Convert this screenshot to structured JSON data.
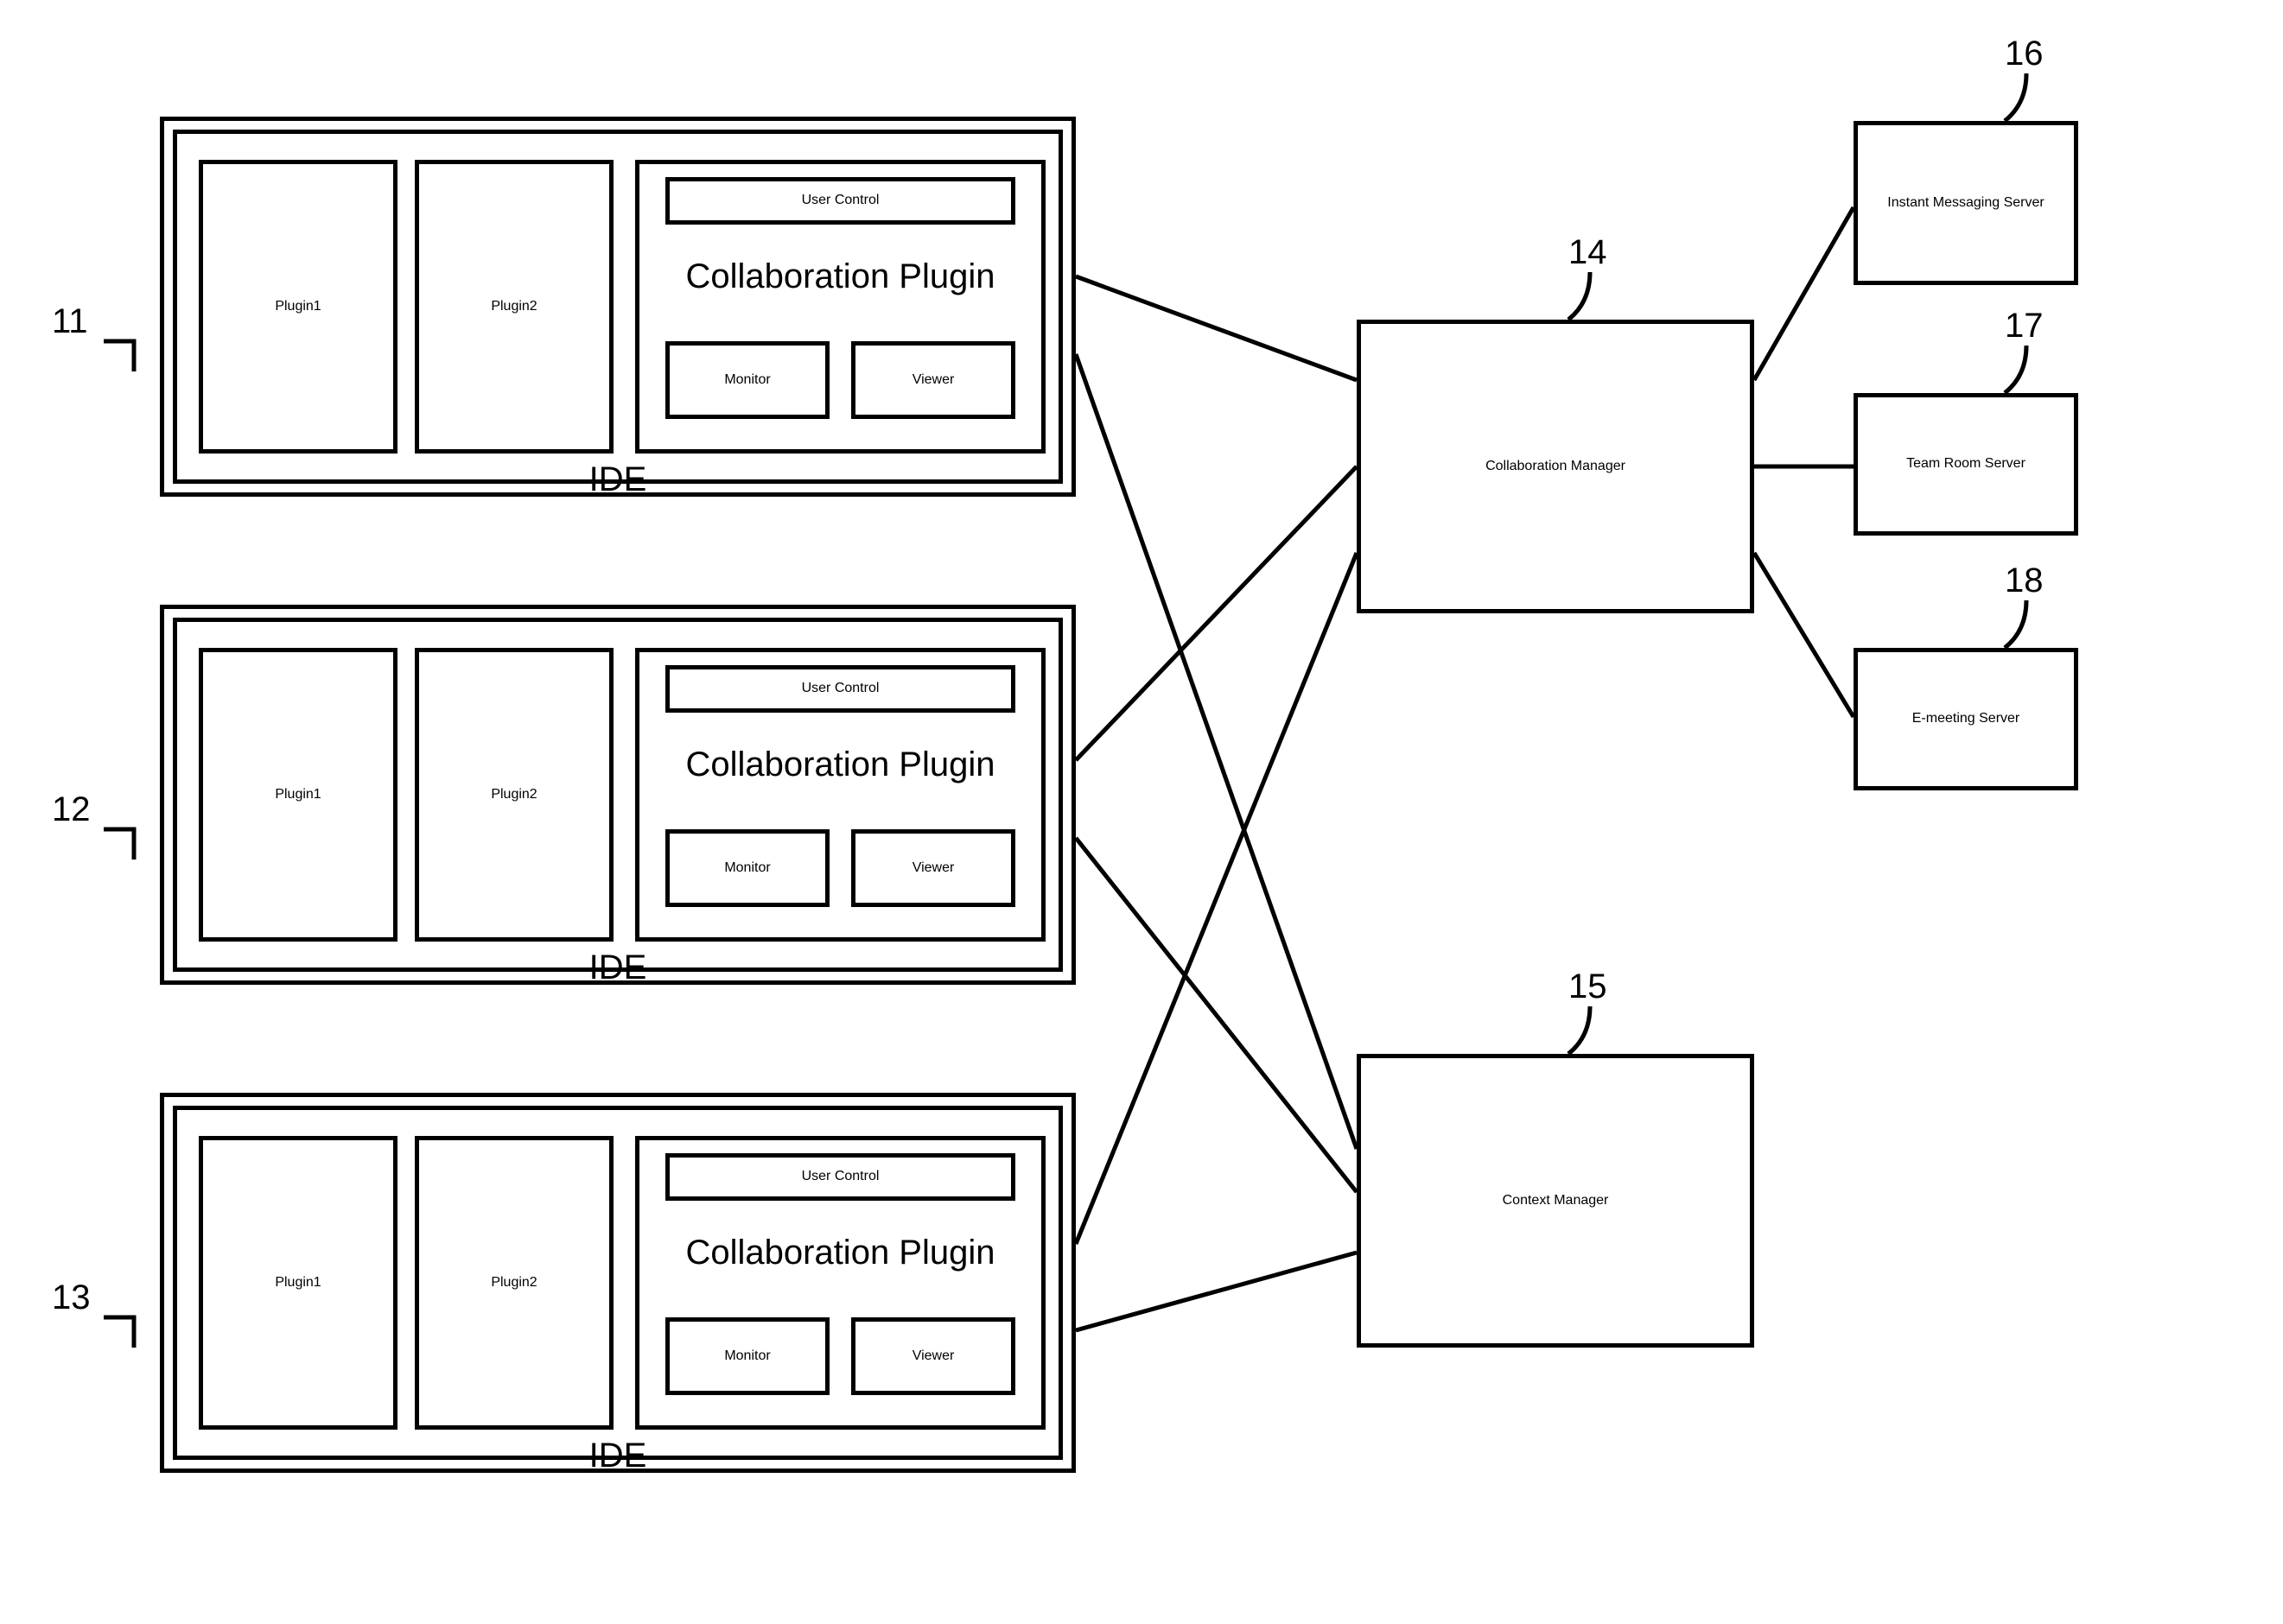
{
  "ide": {
    "label": "IDE",
    "plugin1": "Plugin1",
    "plugin2": "Plugin2",
    "collab": {
      "userControl": "User Control",
      "title": "Collaboration Plugin",
      "monitor": "Monitor",
      "viewer": "Viewer"
    }
  },
  "nums": {
    "n11": "11",
    "n12": "12",
    "n13": "13",
    "n14": "14",
    "n15": "15",
    "n16": "16",
    "n17": "17",
    "n18": "18"
  },
  "managers": {
    "collab": "Collaboration Manager",
    "context": "Context Manager"
  },
  "servers": {
    "im": "Instant Messaging Server",
    "teamroom": "Team Room Server",
    "emeeting": "E-meeting Server"
  }
}
